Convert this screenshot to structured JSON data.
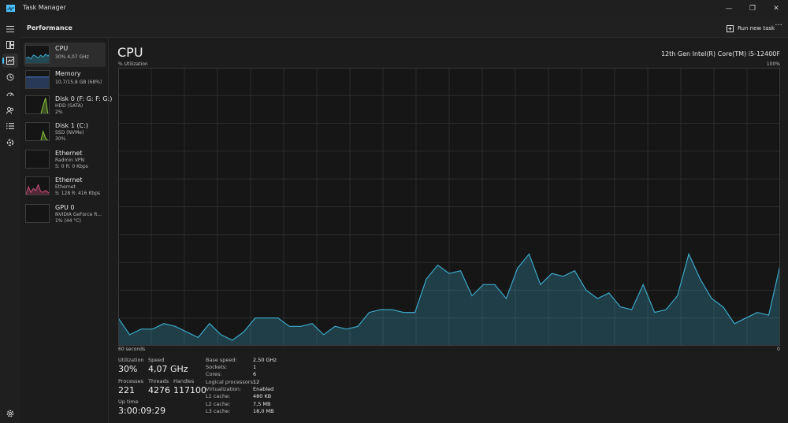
{
  "window": {
    "title": "Task Manager",
    "minimize_glyph": "—",
    "restore_glyph": "❐",
    "close_glyph": "✕"
  },
  "rail": {
    "items": [
      {
        "icon": "hamburger-menu-icon"
      },
      {
        "icon": "processes-icon"
      },
      {
        "icon": "performance-icon"
      },
      {
        "icon": "app-history-icon"
      },
      {
        "icon": "startup-apps-icon"
      },
      {
        "icon": "users-icon"
      },
      {
        "icon": "details-icon"
      },
      {
        "icon": "services-icon"
      },
      {
        "icon": "settings-icon"
      }
    ]
  },
  "header": {
    "title": "Performance",
    "run_task_label": "Run new task",
    "more_label": "···"
  },
  "devices": [
    {
      "name": "CPU",
      "line1": "30% 4,07 GHz",
      "line2": "",
      "color": "#3ba8c9"
    },
    {
      "name": "Memory",
      "line1": "10,7/15,8 GB (68%)",
      "line2": "",
      "color": "#4a7fd1"
    },
    {
      "name": "Disk 0 (F: G: F: G:)",
      "line1": "HDD (SATA)",
      "line2": "2%",
      "color": "#8cc63f"
    },
    {
      "name": "Disk 1 (C:)",
      "line1": "SSD (NVMe)",
      "line2": "30%",
      "color": "#8cc63f"
    },
    {
      "name": "Ethernet",
      "line1": "Radmin VPN",
      "line2": "S: 0 R: 0 Kbps",
      "color": "#c94f7c"
    },
    {
      "name": "Ethernet",
      "line1": "Ethernet",
      "line2": "S: 128 R: 416 Kbps",
      "color": "#c94f7c"
    },
    {
      "name": "GPU 0",
      "line1": "NVIDIA GeForce R...",
      "line2": "1% (44 °C)",
      "color": "#3ba8c9"
    }
  ],
  "main": {
    "title": "CPU",
    "model": "12th Gen Intel(R) Core(TM) i5-12400F",
    "axis_top_left": "% Utilization",
    "axis_top_right": "100%",
    "axis_bottom_left": "60 seconds",
    "axis_bottom_right": "0",
    "accent": "#3ba8c9"
  },
  "stats": {
    "utilization_label": "Utilization",
    "utilization": "30%",
    "speed_label": "Speed",
    "speed": "4,07 GHz",
    "processes_label": "Processes",
    "processes": "221",
    "threads_label": "Threads",
    "threads": "4276",
    "handles_label": "Handles",
    "handles": "117100",
    "uptime_label": "Up time",
    "uptime": "3:00:09:29"
  },
  "specs": [
    {
      "label": "Base speed:",
      "value": "2,50 GHz"
    },
    {
      "label": "Sockets:",
      "value": "1"
    },
    {
      "label": "Cores:",
      "value": "6"
    },
    {
      "label": "Logical processors:",
      "value": "12"
    },
    {
      "label": "Virtualization:",
      "value": "Enabled"
    },
    {
      "label": "L1 cache:",
      "value": "480 KB"
    },
    {
      "label": "L2 cache:",
      "value": "7,5 MB"
    },
    {
      "label": "L3 cache:",
      "value": "18,0 MB"
    }
  ],
  "chart_data": {
    "type": "area",
    "ylabel": "% Utilization",
    "xlabel": "60 seconds",
    "ylim": [
      0,
      100
    ],
    "xlim": [
      60,
      0
    ],
    "grid": true,
    "series": [
      {
        "values": [
          10,
          4,
          6,
          6,
          8,
          7,
          5,
          3,
          8,
          4,
          2,
          5,
          10,
          10,
          10,
          7,
          7,
          8,
          4,
          7,
          6,
          7,
          12,
          13,
          13,
          12,
          12,
          24,
          29,
          26,
          27,
          18,
          22,
          22,
          17,
          28,
          33,
          22,
          26,
          25,
          27,
          20,
          17,
          19,
          14,
          13,
          22,
          12,
          13,
          18,
          33,
          24,
          17,
          14,
          8,
          10,
          12,
          11,
          29
        ]
      }
    ]
  }
}
